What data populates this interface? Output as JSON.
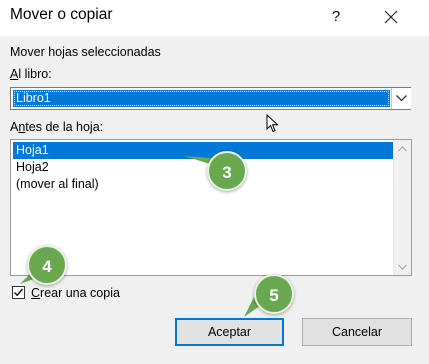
{
  "window": {
    "title": "Mover o copiar",
    "help_icon": "?",
    "close_icon": "close"
  },
  "section": {
    "heading": "Mover hojas seleccionadas"
  },
  "book": {
    "label_prefix": "A",
    "label_rest": "l libro:",
    "selected": "Libro1"
  },
  "before_sheet": {
    "label_prefix": "A",
    "label_underlined": "n",
    "label_rest": "tes de la hoja:",
    "items": [
      "Hoja1",
      "Hoja2",
      "(mover al final)"
    ],
    "selected_index": 0
  },
  "copy_option": {
    "label_prefix": "",
    "label_underlined": "C",
    "label_rest": "rear una copia",
    "checked": true
  },
  "buttons": {
    "accept": "Aceptar",
    "cancel": "Cancelar"
  },
  "annotations": {
    "badge_3": "3",
    "badge_4": "4",
    "badge_5": "5"
  },
  "colors": {
    "selection": "#0078d7",
    "badge": "#6aa84f",
    "accent_border": "#0078d7"
  }
}
